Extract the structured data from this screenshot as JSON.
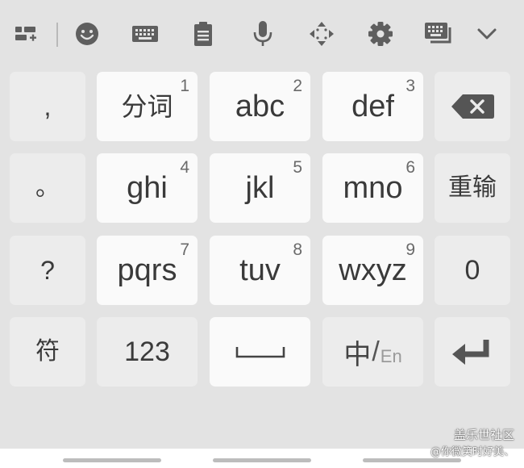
{
  "toolbar": {
    "icons": [
      "apps-add-icon",
      "emoji-icon",
      "keyboard-icon",
      "clipboard-icon",
      "microphone-icon",
      "cursor-move-icon",
      "settings-icon",
      "keyboard-layout-icon",
      "chevron-down-icon"
    ]
  },
  "keys": {
    "row1": {
      "comma": ",",
      "k1": {
        "label": "分词",
        "num": "1"
      },
      "k2": {
        "label": "abc",
        "num": "2"
      },
      "k3": {
        "label": "def",
        "num": "3"
      }
    },
    "row2": {
      "period": "。",
      "k4": {
        "label": "ghi",
        "num": "4"
      },
      "k5": {
        "label": "jkl",
        "num": "5"
      },
      "k6": {
        "label": "mno",
        "num": "6"
      },
      "reinput": "重输"
    },
    "row3": {
      "question": "?",
      "k7": {
        "label": "pqrs",
        "num": "7"
      },
      "k8": {
        "label": "tuv",
        "num": "8"
      },
      "k9": {
        "label": "wxyz",
        "num": "9"
      },
      "zero": "0"
    },
    "row4": {
      "symbols": "符",
      "numbers": "123",
      "lang_cn": "中",
      "lang_sep": "/",
      "lang_en": "En"
    }
  },
  "watermark": {
    "line1": "盖乐世社区",
    "line2": "@你微笑时好美、"
  },
  "colors": {
    "background": "#e3e3e3",
    "key_white": "#fafafa",
    "key_gray": "#ececec",
    "text": "#3a3a3a"
  }
}
